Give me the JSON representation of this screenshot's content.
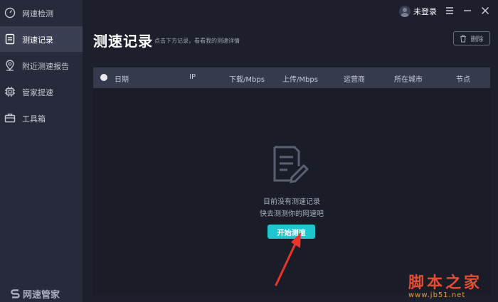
{
  "sidebar": {
    "items": [
      {
        "label": "网速检测",
        "icon": "speedometer-icon"
      },
      {
        "label": "测速记录",
        "icon": "document-icon",
        "active": true
      },
      {
        "label": "附近测速报告",
        "icon": "location-pin-icon"
      },
      {
        "label": "管家提速",
        "icon": "chip-icon"
      },
      {
        "label": "工具箱",
        "icon": "toolbox-icon"
      }
    ],
    "brand": "网速管家"
  },
  "topbar": {
    "user_label": "未登录",
    "window_controls": [
      "menu-icon",
      "minimize-icon",
      "close-icon"
    ]
  },
  "main": {
    "title": "测速记录",
    "subtitle": "点击下方记录，看看我的测速详情",
    "delete_label": "删除",
    "table": {
      "columns": [
        "日期",
        "IP",
        "下载/Mbps",
        "上传/Mbps",
        "运营商",
        "所在城市",
        "节点"
      ]
    },
    "empty": {
      "line1": "目前没有测速记录",
      "line2": "快去测测你的网速吧",
      "button": "开始测速"
    }
  },
  "watermark": {
    "title": "脚本之家",
    "url": "www.jb51.net"
  },
  "colors": {
    "accent": "#1fc6cd",
    "arrow": "#e8342b",
    "sidebar_bg": "#272a3a",
    "page_bg": "#1d1f2c"
  }
}
